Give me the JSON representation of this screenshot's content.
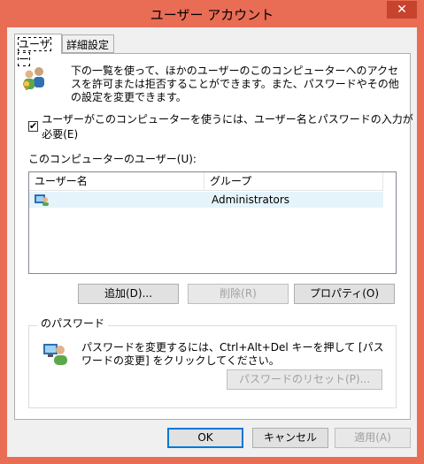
{
  "window": {
    "title": "ユーザー アカウント",
    "close_glyph": "✕"
  },
  "tabs": [
    {
      "label": "ユーザー"
    },
    {
      "label": "詳細設定"
    }
  ],
  "intro_text": "下の一覧を使って、ほかのユーザーのこのコンピューターへのアクセスを許可または拒否することができます。また、パスワードやその他の設定を変更できます。",
  "require_login": {
    "label": "ユーザーがこのコンピューターを使うには、ユーザー名とパスワードの入力が必要(E)",
    "checked": true
  },
  "users_list": {
    "label": "このコンピューターのユーザー(U):",
    "columns": [
      "ユーザー名",
      "グループ"
    ],
    "rows": [
      {
        "user": "",
        "group": "Administrators"
      }
    ]
  },
  "buttons": {
    "add": "追加(D)...",
    "remove": "削除(R)",
    "properties": "プロパティ(O)"
  },
  "password_group": {
    "title": "のパスワード",
    "text": "パスワードを変更するには、Ctrl+Alt+Del キーを押して [パスワードの変更] をクリックしてください。",
    "reset_button": "パスワードのリセット(P)..."
  },
  "dialog_buttons": {
    "ok": "OK",
    "cancel": "キャンセル",
    "apply": "適用(A)"
  }
}
